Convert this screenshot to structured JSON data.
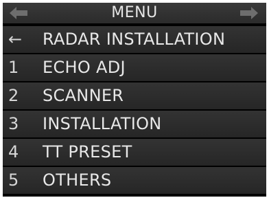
{
  "header": {
    "title": "MENU",
    "prev_icon": "arrow-left-icon",
    "next_icon": "arrow-right-icon"
  },
  "menu": {
    "items": [
      {
        "key": "←",
        "label": "RADAR INSTALLATION"
      },
      {
        "key": "1",
        "label": "ECHO ADJ"
      },
      {
        "key": "2",
        "label": "SCANNER"
      },
      {
        "key": "3",
        "label": "INSTALLATION"
      },
      {
        "key": "4",
        "label": "TT PRESET"
      },
      {
        "key": "5",
        "label": "OTHERS"
      }
    ]
  },
  "colors": {
    "background": "#000000",
    "row": "#2e2e2e",
    "text": "#e8e8e8",
    "arrow": "#6e6e6e"
  }
}
